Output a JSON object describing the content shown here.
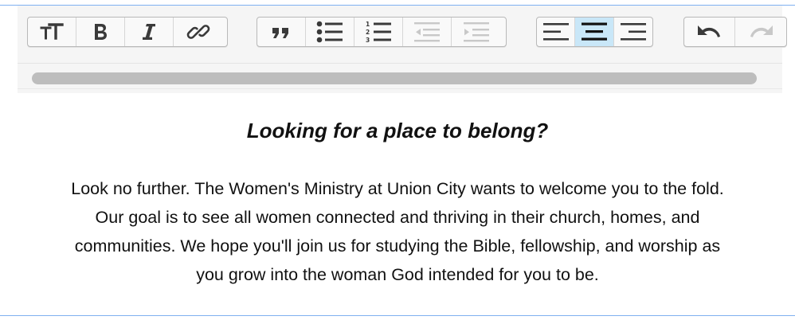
{
  "toolbar": {
    "groups": [
      {
        "name": "text",
        "buttons": [
          {
            "icon": "text-size-icon",
            "label": "Text size"
          },
          {
            "icon": "bold-icon",
            "label": "B"
          },
          {
            "icon": "italic-icon",
            "label": "I"
          },
          {
            "icon": "link-icon",
            "label": "Link"
          }
        ]
      },
      {
        "name": "block",
        "buttons": [
          {
            "icon": "quote-icon",
            "label": "Quote"
          },
          {
            "icon": "bulleted-list-icon",
            "label": "Bulleted list"
          },
          {
            "icon": "numbered-list-icon",
            "label": "Numbered list"
          },
          {
            "icon": "outdent-icon",
            "label": "Decrease indent",
            "disabled": true
          },
          {
            "icon": "indent-icon",
            "label": "Increase indent",
            "disabled": true
          }
        ]
      },
      {
        "name": "align",
        "buttons": [
          {
            "icon": "align-left-icon",
            "label": "Align left"
          },
          {
            "icon": "align-center-icon",
            "label": "Align center",
            "active": true
          },
          {
            "icon": "align-right-icon",
            "label": "Align right"
          }
        ]
      },
      {
        "name": "history",
        "buttons": [
          {
            "icon": "undo-icon",
            "label": "Undo"
          },
          {
            "icon": "redo-icon",
            "label": "Redo",
            "disabled": true
          }
        ]
      }
    ],
    "active_color": "#c9e7f8",
    "border_color": "#7fb0f0"
  },
  "content": {
    "heading": "Looking for a place to belong?",
    "paragraph_lines": [
      "Look no further. The Women's Ministry at Union City wants to welcome you to the fold.",
      "Our goal is to see all women connected and thriving in their church, homes, and",
      "communities. We hope you'll join us for studying the Bible, fellowship, and worship as",
      "you grow into the woman God intended for you to be."
    ]
  }
}
